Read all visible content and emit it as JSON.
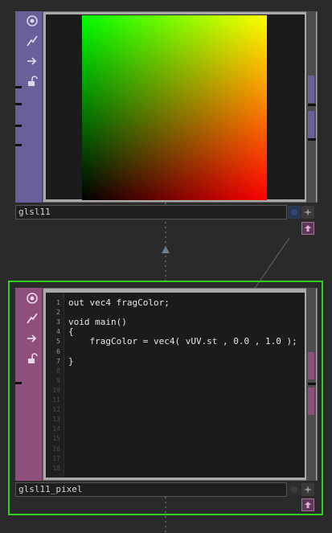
{
  "nodes": {
    "top": {
      "name": "glsl11",
      "side_buttons": [
        "target-icon",
        "bolt-icon",
        "arrow-right-icon",
        "lock-icon"
      ],
      "accent": "#6a5f98"
    },
    "bottom": {
      "name": "glsl11_pixel",
      "side_buttons": [
        "target-icon",
        "bolt-icon",
        "arrow-right-icon",
        "lock-icon"
      ],
      "accent": "#8e4f7d",
      "selection_color": "#33d11f"
    }
  },
  "editor": {
    "line_numbers": [
      "1",
      "2",
      "3",
      "4",
      "5",
      "6",
      "7",
      "8",
      "9",
      "10",
      "11",
      "12",
      "13",
      "14",
      "15",
      "16",
      "17",
      "18"
    ],
    "lines": [
      "out vec4 fragColor;",
      "",
      "void main()",
      "{",
      "    fragColor = vec4( vUV.st , 0.0 , 1.0 );",
      "",
      "}"
    ]
  },
  "preview": {
    "gradient": {
      "top_left": "#00ff00",
      "top_right": "#ffff00",
      "bottom_left": "#000000",
      "bottom_right": "#ff0000"
    }
  }
}
